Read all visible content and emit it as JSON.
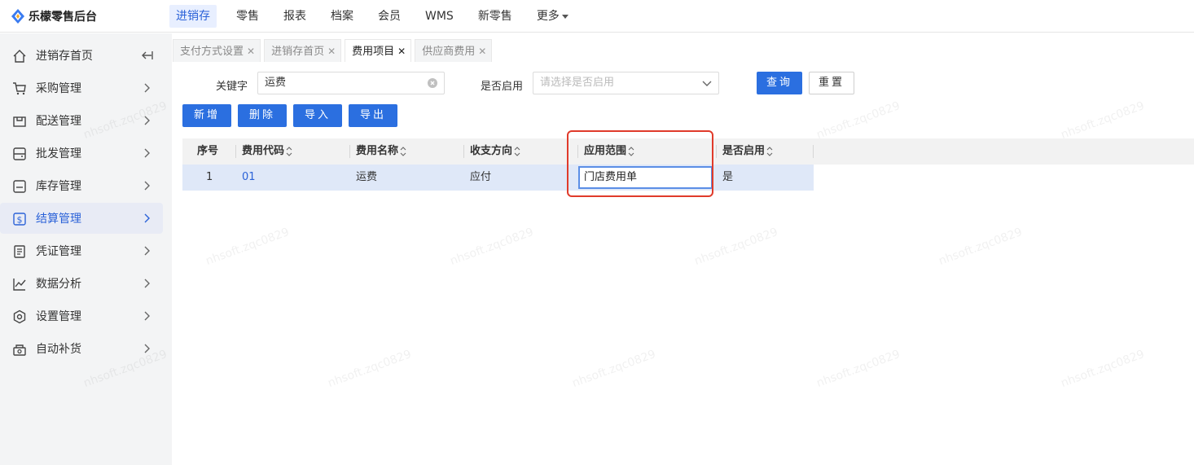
{
  "app": {
    "title": "乐檬零售后台"
  },
  "nav": {
    "items": [
      {
        "label": "进销存",
        "active": true
      },
      {
        "label": "零售"
      },
      {
        "label": "报表"
      },
      {
        "label": "档案"
      },
      {
        "label": "会员"
      },
      {
        "label": "WMS"
      },
      {
        "label": "新零售"
      },
      {
        "label": "更多"
      }
    ]
  },
  "sidebar": {
    "items": [
      {
        "label": "进销存首页",
        "icon": "home-icon"
      },
      {
        "label": "采购管理",
        "icon": "cart-icon"
      },
      {
        "label": "配送管理",
        "icon": "delivery-box-icon"
      },
      {
        "label": "批发管理",
        "icon": "wholesale-icon"
      },
      {
        "label": "库存管理",
        "icon": "inventory-icon"
      },
      {
        "label": "结算管理",
        "icon": "dollar-icon",
        "active": true
      },
      {
        "label": "凭证管理",
        "icon": "document-icon"
      },
      {
        "label": "数据分析",
        "icon": "chart-line-icon"
      },
      {
        "label": "设置管理",
        "icon": "settings-hexagon-icon"
      },
      {
        "label": "自动补货",
        "icon": "replenish-icon"
      }
    ]
  },
  "tabs": [
    {
      "label": "支付方式设置"
    },
    {
      "label": "进销存首页"
    },
    {
      "label": "费用项目",
      "active": true
    },
    {
      "label": "供应商费用"
    }
  ],
  "filters": {
    "keyword_label": "关键字",
    "keyword_value": "运费",
    "enabled_label": "是否启用",
    "enabled_placeholder": "请选择是否启用",
    "query_button": "查询",
    "reset_button": "重置"
  },
  "toolbar": {
    "add": "新增",
    "delete": "删除",
    "import": "导入",
    "export": "导出"
  },
  "table": {
    "headers": [
      "序号",
      "费用代码",
      "费用名称",
      "收支方向",
      "应用范围",
      "是否启用"
    ],
    "rows": [
      {
        "index": "1",
        "code": "01",
        "name": "运费",
        "direction": "应付",
        "scope": "门店费用单",
        "enabled": "是"
      }
    ]
  },
  "watermark": "nhsoft.zqc0829",
  "colors": {
    "primary": "#2b6fe0",
    "active_nav_bg": "#e8efff",
    "highlight_border": "#e03b2b",
    "selected_row_bg": "#dfe8f8"
  }
}
